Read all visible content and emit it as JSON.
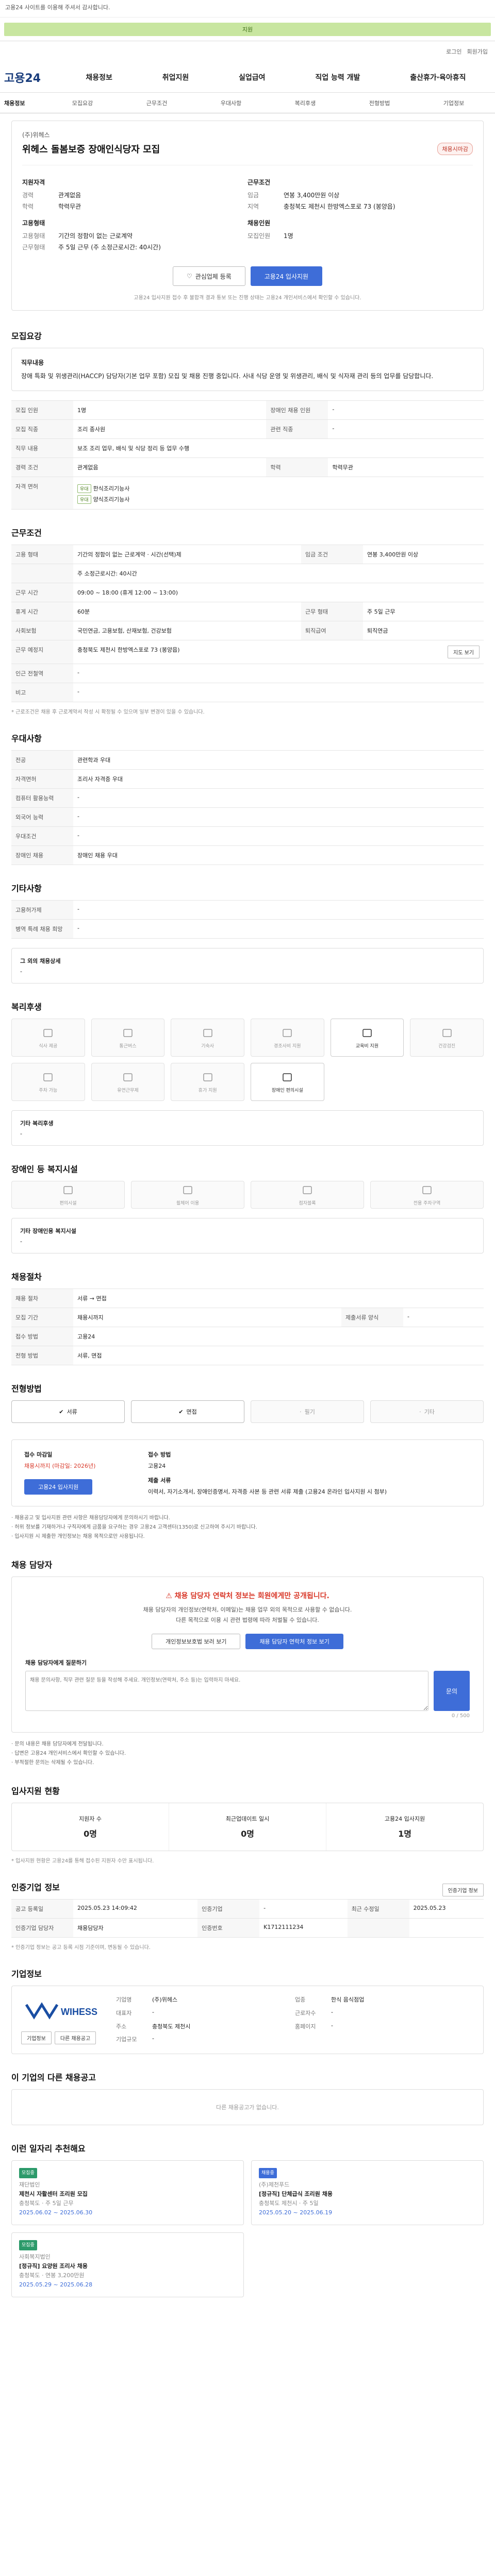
{
  "top": {
    "notice": "고용24 사이트를 이용해 주셔서 감사합니다.",
    "banner": "지원",
    "login": "로그인",
    "join": "회원가입",
    "logo": "고용24"
  },
  "gnb": [
    "채용정보",
    "취업지원",
    "실업급여",
    "직업 능력 개발",
    "출산휴가·육아휴직"
  ],
  "tabs": [
    "모집요강",
    "근무조건",
    "우대사항",
    "복리후생",
    "전형방법",
    "기업정보"
  ],
  "tab_first": "채용정보",
  "header": {
    "company": "(주)위헤스",
    "title": "위헤스 돌봄보증 장애인식당자 모집",
    "badge": "채용시마감",
    "left_sub": "지원자격",
    "right_sub": "근무조건",
    "left_rows": [
      {
        "k": "경력",
        "v": "관계없음"
      },
      {
        "k": "학력",
        "v": "학력무관"
      }
    ],
    "left_sub2": "고용형태",
    "left_rows2": [
      {
        "k": "고용형태",
        "v": "기간의 정함이 없는 근로계약"
      },
      {
        "k": "근무형태",
        "v": "주 5일 근무 (주 소정근로시간: 40시간)"
      }
    ],
    "right_rows": [
      {
        "k": "임금",
        "v": "연봉 3,400만원 이상"
      },
      {
        "k": "지역",
        "v": "충청북도 제천시 한방엑스포로 73 (봉양읍)"
      }
    ],
    "right_sub2": "채용인원",
    "right_rows2": [
      {
        "k": "모집인원",
        "v": "1명"
      }
    ],
    "btn_save": "관심업체 등록",
    "btn_apply": "고용24 입사지원",
    "fine": "고용24 입사지원 접수 후 불합격 결과 통보 또는 진행 상태는 고용24 개인서비스에서 확인할 수 있습니다."
  },
  "recruit": {
    "title": "모집요강",
    "head": "직무내용",
    "body": "장애 특화 및 위생관리(HACCP) 담당자(기본 업무 포함) 모집 및 채용 진행 중입니다. 사내 식당 운영 및 위생관리, 배식 및 식자재 관리 등의 업무를 담당합니다.",
    "rows": [
      {
        "k": "모집 인원",
        "v": "1명",
        "k2": "장애인 채용 인원",
        "v2": "-"
      },
      {
        "k": "모집 직종",
        "v": "조리 종사원",
        "k2": "관련 직종",
        "v2": "-"
      },
      {
        "k": "직무 내용",
        "v": "보조 조리 업무, 배식 및 식당 정리 등 업무 수행",
        "k2": "",
        "v2": ""
      },
      {
        "k": "경력 조건",
        "v": "관계없음",
        "k2": "학력",
        "v2": "학력무관"
      },
      {
        "k": "자격 면허",
        "v": "",
        "k2": "",
        "v2": ""
      }
    ],
    "licenses": [
      {
        "tag": "우대",
        "name": "한식조리기능사"
      },
      {
        "tag": "우대",
        "name": "양식조리기능사"
      }
    ]
  },
  "work": {
    "title": "근무조건",
    "rows": [
      {
        "k": "고용 형태",
        "v": "기간의 정함이 없는 근로계약 · 시간(선택)제",
        "k2": "임금 조건",
        "v2": "연봉 3,400만원 이상"
      },
      {
        "k": "",
        "v": "주 소정근로시간: 40시간",
        "k2": "",
        "v2": ""
      },
      {
        "k": "근무 시간",
        "v": "09:00 ~ 18:00 (휴게 12:00 ~ 13:00)",
        "k2": "",
        "v2": ""
      },
      {
        "k": "휴게 시간",
        "v": "60분",
        "k2": "근무 형태",
        "v2": "주 5일 근무"
      },
      {
        "k": "사회보험",
        "v": "국민연금, 고용보험, 산재보험, 건강보험",
        "k2": "퇴직급여",
        "v2": "퇴직연금"
      },
      {
        "k": "근무 예정지",
        "v": "충청북도 제천시 한방엑스포로 73 (봉양읍)",
        "k2": "",
        "v2": ""
      },
      {
        "k": "인근 전철역",
        "v": "-",
        "k2": "",
        "v2": ""
      },
      {
        "k": "비고",
        "v": "-",
        "k2": "",
        "v2": ""
      }
    ],
    "map_btn": "지도 보기",
    "note": "* 근로조건은 채용 후 근로계약서 작성 시 확정될 수 있으며 일부 변경이 있을 수 있습니다."
  },
  "pref": {
    "title": "우대사항",
    "rows": [
      {
        "k": "전공",
        "v": "관련학과 우대"
      },
      {
        "k": "자격면허",
        "v": "조리사 자격증 우대"
      },
      {
        "k": "컴퓨터 활용능력",
        "v": "-"
      },
      {
        "k": "외국어 능력",
        "v": "-"
      },
      {
        "k": "우대조건",
        "v": "-"
      },
      {
        "k": "장애인 채용",
        "v": "장애인 채용 우대"
      }
    ]
  },
  "etc": {
    "title": "기타사항",
    "rows": [
      {
        "k": "고용허가제",
        "v": "-"
      },
      {
        "k": "병역 특례 채용 희망",
        "v": "-"
      }
    ],
    "box_title": "그 외의 채용상세",
    "box_body": "-"
  },
  "welfare": {
    "title": "복리후생",
    "items": [
      {
        "icon": "coffee-icon",
        "label": "식사 제공"
      },
      {
        "icon": "bus-icon",
        "label": "통근버스"
      },
      {
        "icon": "home-icon",
        "label": "기숙사"
      },
      {
        "icon": "gift-icon",
        "label": "경조사비 지원"
      },
      {
        "icon": "graduation-icon",
        "label": "교육비 지원"
      },
      {
        "icon": "heart-icon",
        "label": "건강검진"
      },
      {
        "icon": "car-icon",
        "label": "주차 가능"
      },
      {
        "icon": "clock-icon",
        "label": "유연근무제"
      },
      {
        "icon": "briefcase-icon",
        "label": "휴가 지원"
      },
      {
        "icon": "wheelchair-icon",
        "label": "장애인 편의시설"
      }
    ],
    "on": [
      4,
      9
    ],
    "box_title": "기타 복리후생",
    "box_body": "-"
  },
  "disability": {
    "title": "장애인 등 복지시설",
    "items": [
      "편의시설",
      "휠체어 이용",
      "점자블록",
      "전용 주차구역"
    ],
    "box_title": "기타 장애인용 복지시설",
    "box_body": "-"
  },
  "screening": {
    "title": "채용절차",
    "rows": [
      {
        "k": "채용 절차",
        "v": "서류 → 면접",
        "k2": "",
        "v2": ""
      },
      {
        "k": "모집 기간",
        "v": "채용시까지",
        "k2": "제출서류 양식",
        "v2": "-"
      },
      {
        "k": "접수 방법",
        "v": "고용24",
        "k2": "",
        "v2": ""
      },
      {
        "k": "전형 방법",
        "v": "서류, 면접",
        "k2": "",
        "v2": ""
      }
    ]
  },
  "method": {
    "title": "전형방법",
    "items": [
      "서류",
      "면접",
      "필기",
      "기타"
    ],
    "on": [
      0,
      1
    ]
  },
  "apply": {
    "left_label": "접수 마감일",
    "left_value": "채용시까지 (마감일: 2026년)",
    "mid_label": "접수 방법",
    "mid_value": "고용24",
    "docs_label": "제출 서류",
    "docs_value": "이력서, 자기소개서, 장애인증명서, 자격증 사본 등 관련 서류 제출 (고용24 온라인 입사지원 시 첨부)",
    "btn": "고용24 입사지원",
    "notes": [
      "채용공고 및 입사지원 관련 사항은 채용담당자에게 문의하시기 바랍니다.",
      "허위 정보를 기재하거나 구직자에게 금품을 요구하는 경우 고용24 고객센터(1350)로 신고하여 주시기 바랍니다.",
      "입사지원 시 제출한 개인정보는 채용 목적으로만 사용됩니다."
    ]
  },
  "agent": {
    "title": "채용 담당자",
    "warn": "채용 담당자 연락처 정보는 회원에게만 공개됩니다.",
    "text1": "채용 담당자의 개인정보(연락처, 이메일)는 채용 업무 외의 목적으로 사용할 수 없습니다.",
    "text2": "다른 목적으로 이용 시 관련 법령에 따라 처벌될 수 있습니다.",
    "btn1": "개인정보보호법 보러 보기",
    "btn2": "채용 담당자 연락처 정보 보기",
    "qa_title": "채용 담당자에게 질문하기",
    "qa_placeholder": "채용 문의사항, 직무 관련 질문 등을 작성해 주세요. 개인정보(연락처, 주소 등)는 입력하지 마세요.",
    "qa_btn": "문의",
    "qa_count": "0 / 500",
    "notes": [
      "문의 내용은 채용 담당자에게 전달됩니다.",
      "답변은 고용24 개인서비스에서 확인할 수 있습니다.",
      "부적절한 문의는 삭제될 수 있습니다."
    ]
  },
  "status": {
    "title": "입사지원 현황",
    "cols": [
      {
        "label": "지원자 수",
        "value": "0명"
      },
      {
        "label": "최근업데이트 일시",
        "value": "0명"
      },
      {
        "label": "고용24 입사지원",
        "value": "1명"
      }
    ],
    "note": "* 입사지원 현황은 고용24를 통해 접수된 지원자 수만 표시됩니다."
  },
  "info": {
    "title": "인증기업 정보",
    "btn": "인증기업 정보",
    "rows": [
      {
        "k": "공고 등록일",
        "v": "2025.05.23 14:09:42",
        "k2": "인증기업",
        "v2": "-",
        "k3": "최근 수정일",
        "v3": "2025.05.23"
      },
      {
        "k": "인증기업 담당자",
        "v": "채용담당자",
        "k2": "인증번호",
        "v2": "K1712111234",
        "k3": "",
        "v3": ""
      }
    ],
    "note": "* 인증기업 정보는 공고 등록 시점 기준이며, 변동될 수 있습니다."
  },
  "company": {
    "title": "기업정보",
    "logo_text": "WIHESS",
    "rows": [
      {
        "k": "기업명",
        "v": "(주)위헤스",
        "k2": "업종",
        "v2": "한식 음식점업"
      },
      {
        "k": "대표자",
        "v": "-",
        "k2": "근로자수",
        "v2": "-"
      },
      {
        "k": "주소",
        "v": "충청북도 제천시",
        "k2": "홈페이지",
        "v2": "-"
      },
      {
        "k": "기업규모",
        "v": "-",
        "k2": "",
        "v2": ""
      }
    ],
    "btn1": "기업정보",
    "btn2": "다른 채용공고"
  },
  "other": {
    "title": "이 기업의 다른 채용공고",
    "empty": "다른 채용공고가 없습니다."
  },
  "recommend": {
    "title": "이런 일자리 추천해요",
    "cards": [
      {
        "tag": "모집중",
        "tag_color": "green",
        "company": "재단법인",
        "title": "제천시 자활센터 조리원 모집",
        "sub": "충청북도 · 주 5일 근무",
        "date": "2025.06.02 ~ 2025.06.30"
      },
      {
        "tag": "채용중",
        "tag_color": "blue",
        "company": "(주)제천푸드",
        "title": "[정규직] 단체급식 조리원 채용",
        "sub": "충청북도 제천시 · 주 5일",
        "date": "2025.05.20 ~ 2025.06.19"
      },
      {
        "tag": "모집중",
        "tag_color": "green",
        "company": "사회복지법인",
        "title": "[정규직] 요양원 조리사 채용",
        "sub": "충청북도 · 연봉 3,200만원",
        "date": "2025.05.29 ~ 2025.06.28"
      }
    ]
  }
}
